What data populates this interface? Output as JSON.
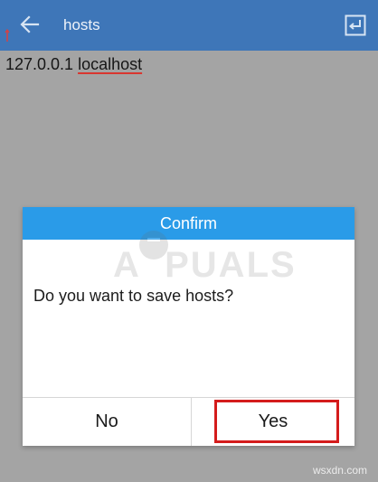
{
  "toolbar": {
    "title": "hosts",
    "back_icon": "arrow-left-icon",
    "enter_icon": "keyboard-return-icon",
    "background_color": "#3e76b8"
  },
  "editor": {
    "line_ip": "127.0.0.1 ",
    "line_host": "localhost"
  },
  "dialog": {
    "title": "Confirm",
    "message": "Do you want to save hosts?",
    "no_label": "No",
    "yes_label": "Yes",
    "header_color": "#2a9be8",
    "highlight_color": "#d41c1c"
  },
  "watermark": {
    "logo_text": "A PUALS"
  },
  "credit": "wsxdn.com"
}
